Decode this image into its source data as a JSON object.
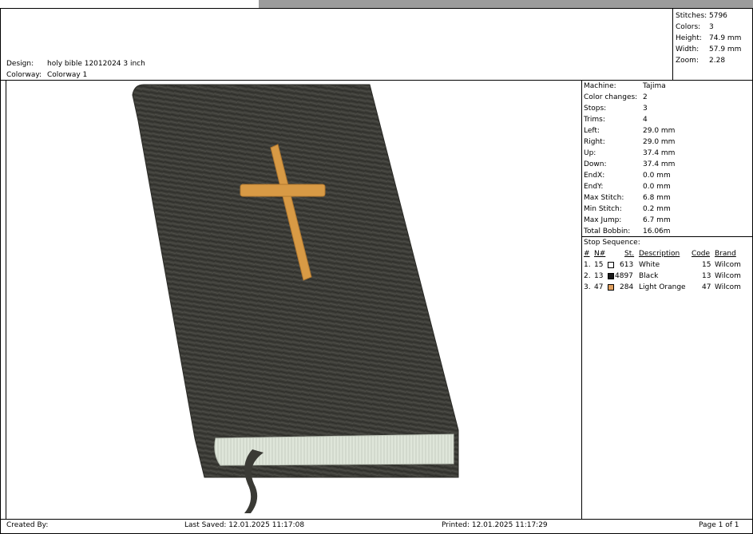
{
  "header": {
    "design_label": "Design:",
    "design_value": "holy bible 12012024 3 inch",
    "colorway_label": "Colorway:",
    "colorway_value": "Colorway 1"
  },
  "summary": [
    {
      "label": "Stitches:",
      "value": "5796"
    },
    {
      "label": "Colors:",
      "value": "3"
    },
    {
      "label": "Height:",
      "value": "74.9 mm"
    },
    {
      "label": "Width:",
      "value": "57.9 mm"
    },
    {
      "label": "Zoom:",
      "value": "2.28"
    }
  ],
  "machine_info": [
    {
      "label": "Machine:",
      "value": "Tajima"
    },
    {
      "label": "Color changes:",
      "value": "2"
    },
    {
      "label": "Stops:",
      "value": "3"
    },
    {
      "label": "Trims:",
      "value": "4"
    },
    {
      "label": "Left:",
      "value": "29.0 mm"
    },
    {
      "label": "Right:",
      "value": "29.0 mm"
    },
    {
      "label": "Up:",
      "value": "37.4 mm"
    },
    {
      "label": "Down:",
      "value": "37.4 mm"
    },
    {
      "label": "EndX:",
      "value": "0.0 mm"
    },
    {
      "label": "EndY:",
      "value": "0.0 mm"
    },
    {
      "label": "Max Stitch:",
      "value": "6.8 mm"
    },
    {
      "label": "Min Stitch:",
      "value": "0.2 mm"
    },
    {
      "label": "Max Jump:",
      "value": "6.7 mm"
    },
    {
      "label": "Total Bobbin:",
      "value": "16.06m"
    }
  ],
  "stop_sequence": {
    "title": "Stop Sequence:",
    "headers": {
      "num": "#",
      "n": "N#",
      "st": "St.",
      "desc": "Description",
      "code": "Code",
      "brand": "Brand"
    },
    "rows": [
      {
        "index": "1.",
        "n": "15",
        "color": "#ffffff",
        "st": "613",
        "desc": "White",
        "code": "15",
        "brand": "Wilcom"
      },
      {
        "index": "2.",
        "n": "13",
        "color": "#1a1a1a",
        "st": "4897",
        "desc": "Black",
        "code": "13",
        "brand": "Wilcom"
      },
      {
        "index": "3.",
        "n": "47",
        "color": "#e0a060",
        "st": "284",
        "desc": "Light Orange",
        "code": "47",
        "brand": "Wilcom"
      }
    ]
  },
  "footer": {
    "created_by": "Created By:",
    "last_saved": "Last Saved: 12.01.2025 11:17:08",
    "printed": "Printed: 12.01.2025 11:17:29",
    "page": "Page 1 of 1"
  },
  "colors": {
    "cover": "#3d3d38",
    "cross": "#d89a45",
    "pages": "#dfe6da",
    "ribbon": "#3a3a35"
  }
}
